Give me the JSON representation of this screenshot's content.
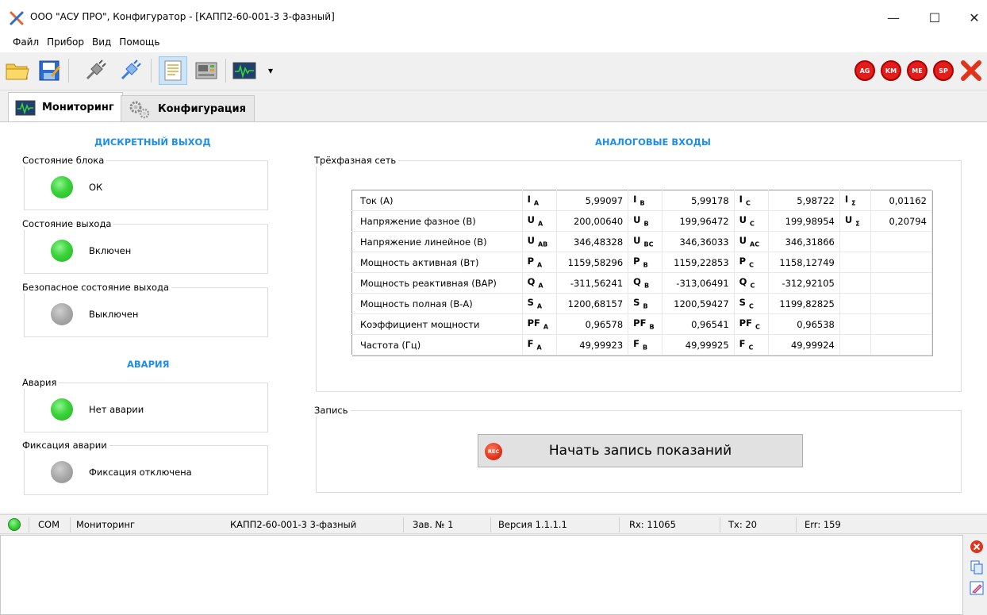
{
  "window": {
    "title": "ООО \"АСУ ПРО\", Конфигуратор - [КАПП2-60-001-3 3-фазный]",
    "minimize": "—",
    "maximize": "☐",
    "close": "✕"
  },
  "menu": [
    "Файл",
    "Прибор",
    "Вид",
    "Помощь"
  ],
  "toolbar": {
    "dropdown_arrow": "▾",
    "badges": [
      "AG",
      "KM",
      "ME",
      "SP"
    ]
  },
  "tabs": {
    "monitoring": "Мониторинг",
    "configuration": "Конфигурация"
  },
  "discrete": {
    "heading": "ДИСКРЕТНЫЙ ВЫХОД",
    "groups": [
      {
        "label": "Состояние блока",
        "text": "ОК",
        "led": "green"
      },
      {
        "label": "Состояние выхода",
        "text": "Включен",
        "led": "green"
      },
      {
        "label": "Безопасное состояние выхода",
        "text": "Выключен",
        "led": "gray"
      }
    ]
  },
  "alarm": {
    "heading": "АВАРИЯ",
    "groups": [
      {
        "label": "Авария",
        "text": "Нет аварии",
        "led": "green"
      },
      {
        "label": "Фиксация аварии",
        "text": "Фиксация отключена",
        "led": "gray"
      }
    ]
  },
  "analog": {
    "heading": "АНАЛОГОВЫЕ ВХОДЫ",
    "group_label": "Трёхфазная сеть",
    "rows": [
      {
        "label": "Ток (А)",
        "a_sym": "I",
        "a_sub": "A",
        "a_val": "5,99097",
        "b_sym": "I",
        "b_sub": "B",
        "b_val": "5,99178",
        "c_sym": "I",
        "c_sub": "C",
        "c_val": "5,98722",
        "s_sym": "I",
        "s_sub": "Σ",
        "s_val": "0,01162"
      },
      {
        "label": "Напряжение фазное (В)",
        "a_sym": "U",
        "a_sub": "A",
        "a_val": "200,00640",
        "b_sym": "U",
        "b_sub": "B",
        "b_val": "199,96472",
        "c_sym": "U",
        "c_sub": "C",
        "c_val": "199,98954",
        "s_sym": "U",
        "s_sub": "Σ",
        "s_val": "0,20794"
      },
      {
        "label": "Напряжение линейное (В)",
        "a_sym": "U",
        "a_sub": "AB",
        "a_val": "346,48328",
        "b_sym": "U",
        "b_sub": "BC",
        "b_val": "346,36033",
        "c_sym": "U",
        "c_sub": "AC",
        "c_val": "346,31866",
        "s_sym": "",
        "s_sub": "",
        "s_val": ""
      },
      {
        "label": "Мощность активная (Вт)",
        "a_sym": "P",
        "a_sub": "A",
        "a_val": "1159,58296",
        "b_sym": "P",
        "b_sub": "B",
        "b_val": "1159,22853",
        "c_sym": "P",
        "c_sub": "C",
        "c_val": "1158,12749",
        "s_sym": "",
        "s_sub": "",
        "s_val": ""
      },
      {
        "label": "Мощность реактивная (ВАР)",
        "a_sym": "Q",
        "a_sub": "A",
        "a_val": "-311,56241",
        "b_sym": "Q",
        "b_sub": "B",
        "b_val": "-313,06491",
        "c_sym": "Q",
        "c_sub": "C",
        "c_val": "-312,92105",
        "s_sym": "",
        "s_sub": "",
        "s_val": ""
      },
      {
        "label": "Мощность полная (В-А)",
        "a_sym": "S",
        "a_sub": "A",
        "a_val": "1200,68157",
        "b_sym": "S",
        "b_sub": "B",
        "b_val": "1200,59427",
        "c_sym": "S",
        "c_sub": "C",
        "c_val": "1199,82825",
        "s_sym": "",
        "s_sub": "",
        "s_val": ""
      },
      {
        "label": "Коэффициент мощности",
        "a_sym": "PF",
        "a_sub": "A",
        "a_val": "0,96578",
        "b_sym": "PF",
        "b_sub": "B",
        "b_val": "0,96541",
        "c_sym": "PF",
        "c_sub": "C",
        "c_val": "0,96538",
        "s_sym": "",
        "s_sub": "",
        "s_val": ""
      },
      {
        "label": "Частота (Гц)",
        "a_sym": "F",
        "a_sub": "A",
        "a_val": "49,99923",
        "b_sym": "F",
        "b_sub": "B",
        "b_val": "49,99925",
        "c_sym": "F",
        "c_sub": "C",
        "c_val": "49,99924",
        "s_sym": "",
        "s_sub": "",
        "s_val": ""
      }
    ]
  },
  "record": {
    "group_label": "Запись",
    "button_label": "Начать запись показаний",
    "rec_icon_text": "REC"
  },
  "status": {
    "port": "COM",
    "mode": "Мониторинг",
    "device": "КАПП2-60-001-3 3-фазный",
    "serial": "Зав. № 1",
    "version": "Версия 1.1.1.1",
    "rx": "Rx: 11065",
    "tx": "Tx: 20",
    "err": "Err: 159"
  },
  "colors": {
    "accent_heading": "#1e8ee8",
    "led_green": "#3bd23b",
    "led_gray": "#a8a8a8",
    "badge_red": "#e31c1c"
  }
}
